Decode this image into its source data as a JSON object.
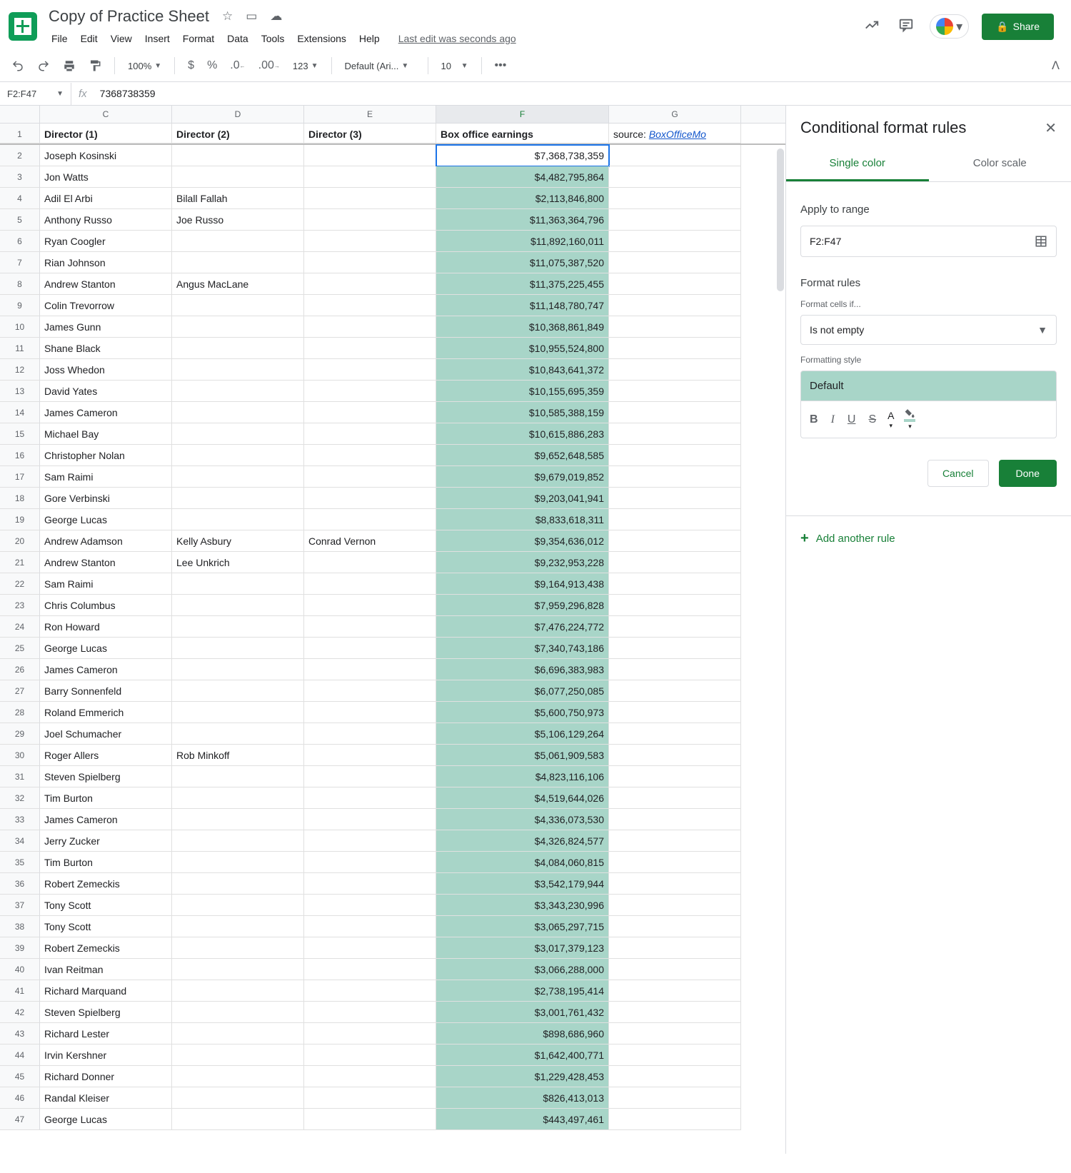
{
  "doc": {
    "title": "Copy of Practice Sheet",
    "last_edit": "Last edit was seconds ago"
  },
  "menus": [
    "File",
    "Edit",
    "View",
    "Insert",
    "Format",
    "Data",
    "Tools",
    "Extensions",
    "Help"
  ],
  "share": "Share",
  "toolbar": {
    "zoom": "100%",
    "font": "Default (Ari...",
    "size": "10"
  },
  "namebox": "F2:F47",
  "formula": "7368738359",
  "cols": [
    "C",
    "D",
    "E",
    "F",
    "G"
  ],
  "headers": {
    "C": "Director (1)",
    "D": "Director (2)",
    "E": "Director (3)",
    "F": "Box office earnings",
    "G_source": "source: ",
    "G_link": "BoxOfficeMo"
  },
  "rows": [
    {
      "n": 2,
      "C": "Joseph Kosinski",
      "F": "$7,368,738,359",
      "active": true
    },
    {
      "n": 3,
      "C": "Jon Watts",
      "F": "$4,482,795,864"
    },
    {
      "n": 4,
      "C": "Adil El Arbi",
      "D": "Bilall Fallah",
      "F": "$2,113,846,800"
    },
    {
      "n": 5,
      "C": "Anthony Russo",
      "D": "Joe Russo",
      "F": "$11,363,364,796"
    },
    {
      "n": 6,
      "C": "Ryan Coogler",
      "F": "$11,892,160,011"
    },
    {
      "n": 7,
      "C": "Rian Johnson",
      "F": "$11,075,387,520"
    },
    {
      "n": 8,
      "C": "Andrew Stanton",
      "D": "Angus MacLane",
      "F": "$11,375,225,455"
    },
    {
      "n": 9,
      "C": "Colin Trevorrow",
      "F": "$11,148,780,747"
    },
    {
      "n": 10,
      "C": "James Gunn",
      "F": "$10,368,861,849"
    },
    {
      "n": 11,
      "C": "Shane Black",
      "F": "$10,955,524,800"
    },
    {
      "n": 12,
      "C": "Joss Whedon",
      "F": "$10,843,641,372"
    },
    {
      "n": 13,
      "C": "David Yates",
      "F": "$10,155,695,359"
    },
    {
      "n": 14,
      "C": "James Cameron",
      "F": "$10,585,388,159"
    },
    {
      "n": 15,
      "C": "Michael Bay",
      "F": "$10,615,886,283"
    },
    {
      "n": 16,
      "C": "Christopher Nolan",
      "F": "$9,652,648,585"
    },
    {
      "n": 17,
      "C": "Sam Raimi",
      "F": "$9,679,019,852"
    },
    {
      "n": 18,
      "C": "Gore Verbinski",
      "F": "$9,203,041,941"
    },
    {
      "n": 19,
      "C": "George Lucas",
      "F": "$8,833,618,311"
    },
    {
      "n": 20,
      "C": "Andrew Adamson",
      "D": "Kelly Asbury",
      "E": "Conrad Vernon",
      "F": "$9,354,636,012"
    },
    {
      "n": 21,
      "C": "Andrew Stanton",
      "D": "Lee Unkrich",
      "F": "$9,232,953,228"
    },
    {
      "n": 22,
      "C": "Sam Raimi",
      "F": "$9,164,913,438"
    },
    {
      "n": 23,
      "C": "Chris Columbus",
      "F": "$7,959,296,828"
    },
    {
      "n": 24,
      "C": "Ron Howard",
      "F": "$7,476,224,772"
    },
    {
      "n": 25,
      "C": "George Lucas",
      "F": "$7,340,743,186"
    },
    {
      "n": 26,
      "C": "James Cameron",
      "F": "$6,696,383,983"
    },
    {
      "n": 27,
      "C": "Barry Sonnenfeld",
      "F": "$6,077,250,085"
    },
    {
      "n": 28,
      "C": "Roland Emmerich",
      "F": "$5,600,750,973"
    },
    {
      "n": 29,
      "C": "Joel Schumacher",
      "F": "$5,106,129,264"
    },
    {
      "n": 30,
      "C": "Roger Allers",
      "D": "Rob Minkoff",
      "F": "$5,061,909,583"
    },
    {
      "n": 31,
      "C": "Steven Spielberg",
      "F": "$4,823,116,106"
    },
    {
      "n": 32,
      "C": "Tim Burton",
      "F": "$4,519,644,026"
    },
    {
      "n": 33,
      "C": "James Cameron",
      "F": "$4,336,073,530"
    },
    {
      "n": 34,
      "C": "Jerry Zucker",
      "F": "$4,326,824,577"
    },
    {
      "n": 35,
      "C": "Tim Burton",
      "F": "$4,084,060,815"
    },
    {
      "n": 36,
      "C": "Robert Zemeckis",
      "F": "$3,542,179,944"
    },
    {
      "n": 37,
      "C": "Tony Scott",
      "F": "$3,343,230,996"
    },
    {
      "n": 38,
      "C": "Tony Scott",
      "F": "$3,065,297,715"
    },
    {
      "n": 39,
      "C": "Robert Zemeckis",
      "F": "$3,017,379,123"
    },
    {
      "n": 40,
      "C": "Ivan Reitman",
      "F": "$3,066,288,000"
    },
    {
      "n": 41,
      "C": "Richard Marquand",
      "F": "$2,738,195,414"
    },
    {
      "n": 42,
      "C": "Steven Spielberg",
      "F": "$3,001,761,432"
    },
    {
      "n": 43,
      "C": "Richard Lester",
      "F": "$898,686,960"
    },
    {
      "n": 44,
      "C": "Irvin Kershner",
      "F": "$1,642,400,771"
    },
    {
      "n": 45,
      "C": "Richard Donner",
      "F": "$1,229,428,453"
    },
    {
      "n": 46,
      "C": "Randal Kleiser",
      "F": "$826,413,013"
    },
    {
      "n": 47,
      "C": "George Lucas",
      "F": "$443,497,461"
    }
  ],
  "sidepanel": {
    "title": "Conditional format rules",
    "tab1": "Single color",
    "tab2": "Color scale",
    "apply_label": "Apply to range",
    "range": "F2:F47",
    "rules_label": "Format rules",
    "cells_if": "Format cells if...",
    "condition": "Is not empty",
    "style_label": "Formatting style",
    "style_preview": "Default",
    "cancel": "Cancel",
    "done": "Done",
    "add_rule": "Add another rule"
  }
}
